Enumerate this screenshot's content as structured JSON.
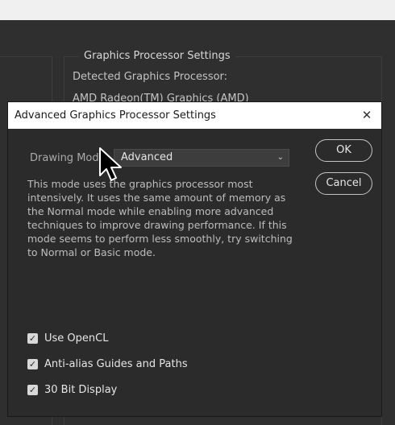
{
  "background": {
    "group_title": "Graphics Processor Settings",
    "detected_label": "Detected Graphics Processor:",
    "gpu_name": "AMD Radeon(TM) Graphics (AMD)"
  },
  "dialog": {
    "title": "Advanced Graphics Processor Settings",
    "close_icon": "close-icon",
    "drawing_mode_label": "Drawing Mode:",
    "drawing_mode_value": "Advanced",
    "description": "This mode uses the graphics processor most intensively.  It uses the same amount of memory as the Normal mode while enabling more advanced techniques to improve drawing performance.  If this mode seems to perform less smoothly, try switching to Normal or Basic mode.",
    "ok_label": "OK",
    "cancel_label": "Cancel",
    "options": [
      {
        "label": "Use OpenCL",
        "checked": true
      },
      {
        "label": "Anti-alias Guides and Paths",
        "checked": true
      },
      {
        "label": "30 Bit Display",
        "checked": true
      }
    ]
  }
}
